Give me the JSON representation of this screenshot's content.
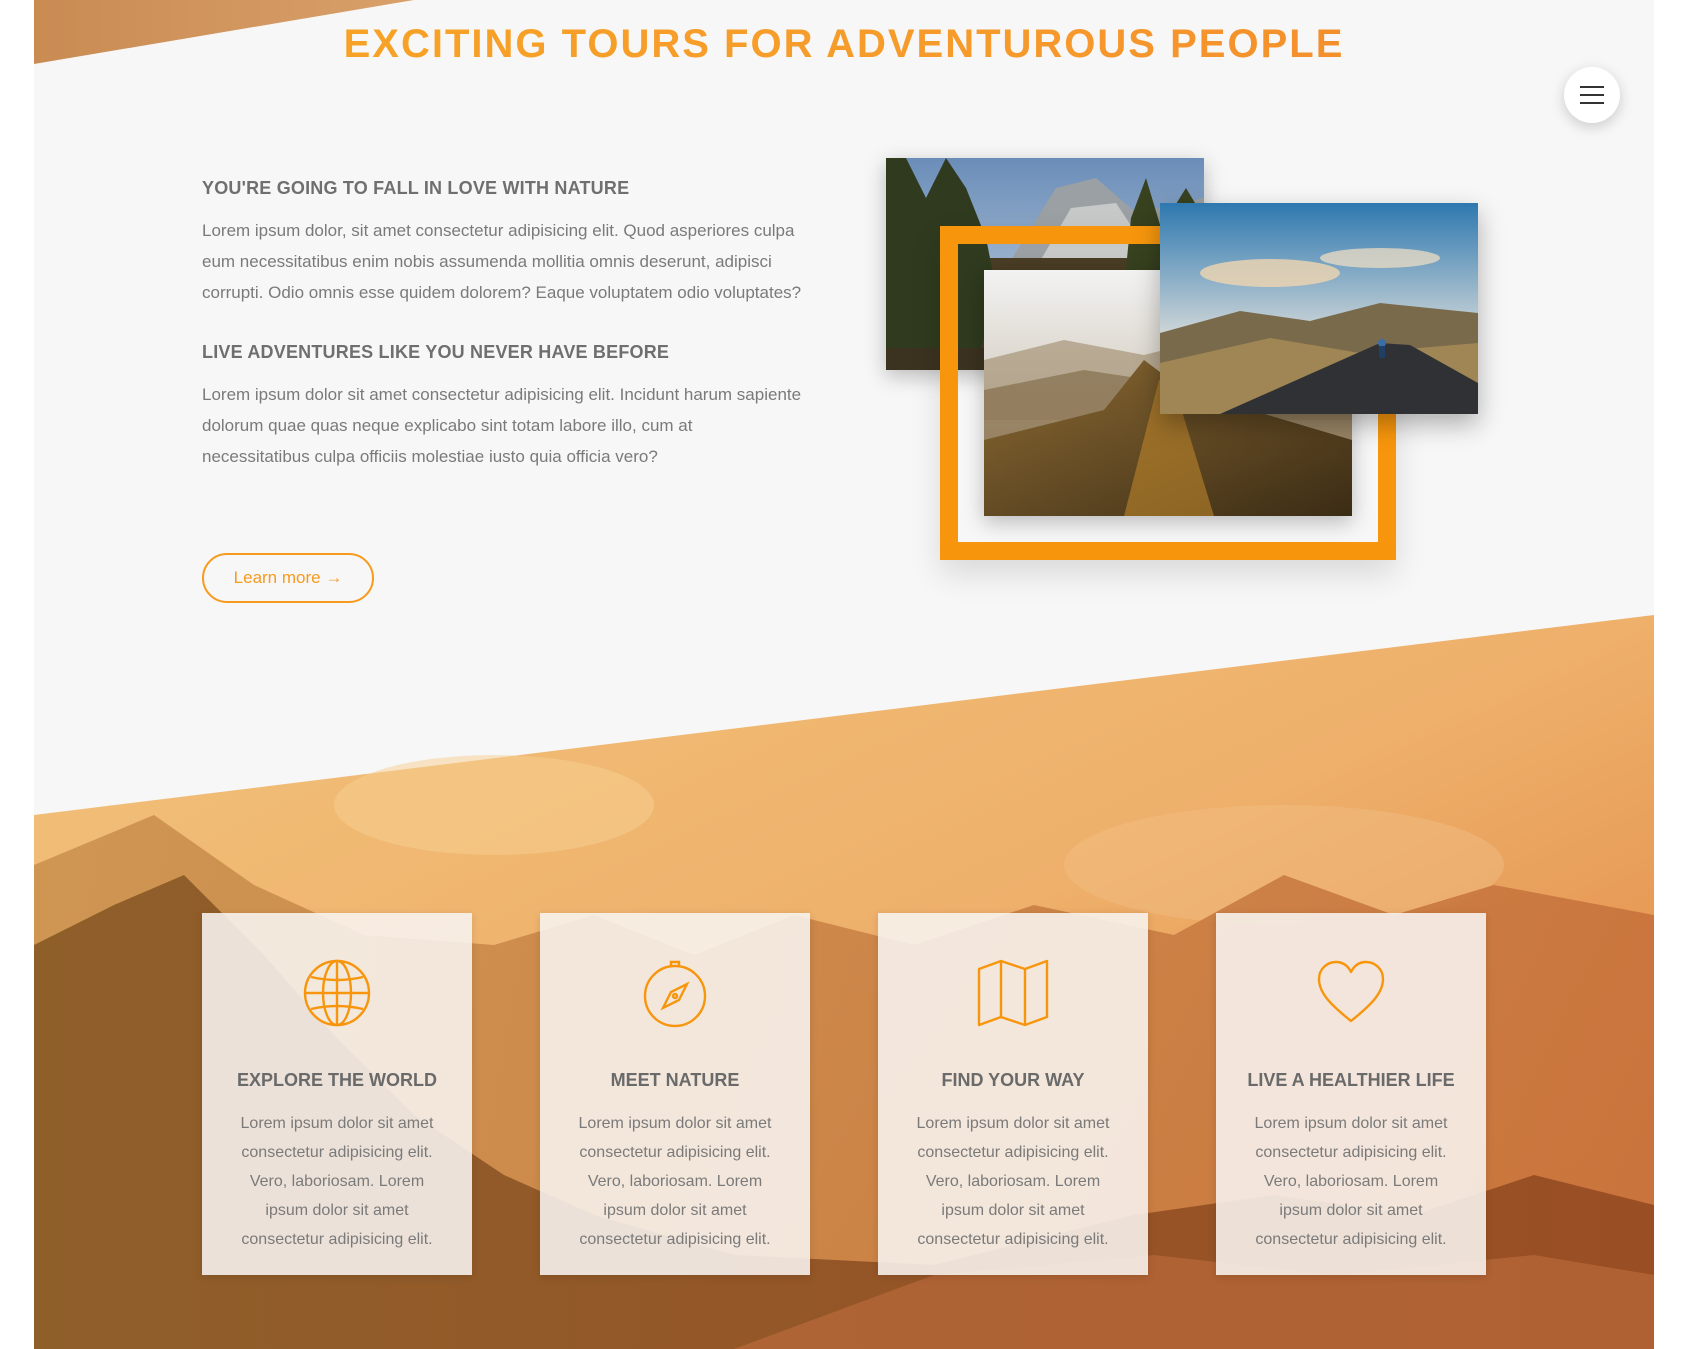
{
  "header": {
    "title": "EXCITING TOURS FOR ADVENTUROUS PEOPLE",
    "menu_icon": "hamburger-menu-icon"
  },
  "intro": {
    "section1_title": "YOU'RE GOING TO FALL IN LOVE WITH NATURE",
    "section1_text": "Lorem ipsum dolor, sit amet consectetur adipisicing elit. Quod asperiores culpa eum necessitatibus enim nobis assumenda mollitia omnis deserunt, adipisci corrupti. Odio omnis esse quidem dolorem? Eaque voluptatem odio voluptates?",
    "section2_title": "LIVE ADVENTURES LIKE YOU NEVER HAVE BEFORE",
    "section2_text": "Lorem ipsum dolor sit amet consectetur adipisicing elit. Incidunt harum sapiente dolorum quae quas neque explicabo sint totam labore illo, cum at necessitatibus culpa officiis molestiae iusto quia officia vero?",
    "button_label": "Learn more →"
  },
  "features": [
    {
      "icon": "globe-icon",
      "title": "EXPLORE THE WORLD",
      "text": "Lorem ipsum dolor sit amet consectetur adipisicing elit. Vero, laboriosam. Lorem ipsum dolor sit amet consectetur adipisicing elit."
    },
    {
      "icon": "compass-icon",
      "title": "MEET NATURE",
      "text": "Lorem ipsum dolor sit amet consectetur adipisicing elit. Vero, laboriosam. Lorem ipsum dolor sit amet consectetur adipisicing elit."
    },
    {
      "icon": "map-icon",
      "title": "FIND YOUR WAY",
      "text": "Lorem ipsum dolor sit amet consectetur adipisicing elit. Vero, laboriosam. Lorem ipsum dolor sit amet consectetur adipisicing elit."
    },
    {
      "icon": "heart-icon",
      "title": "LIVE A HEALTHIER LIFE",
      "text": "Lorem ipsum dolor sit amet consectetur adipisicing elit. Vero, laboriosam. Lorem ipsum dolor sit amet consectetur adipisicing elit."
    }
  ],
  "colors": {
    "accent": "#f7960d",
    "accent_light": "#f7a623",
    "heading_text": "#6f6f6f",
    "body_text": "#7a7a7a",
    "background": "#f7f7f7"
  }
}
